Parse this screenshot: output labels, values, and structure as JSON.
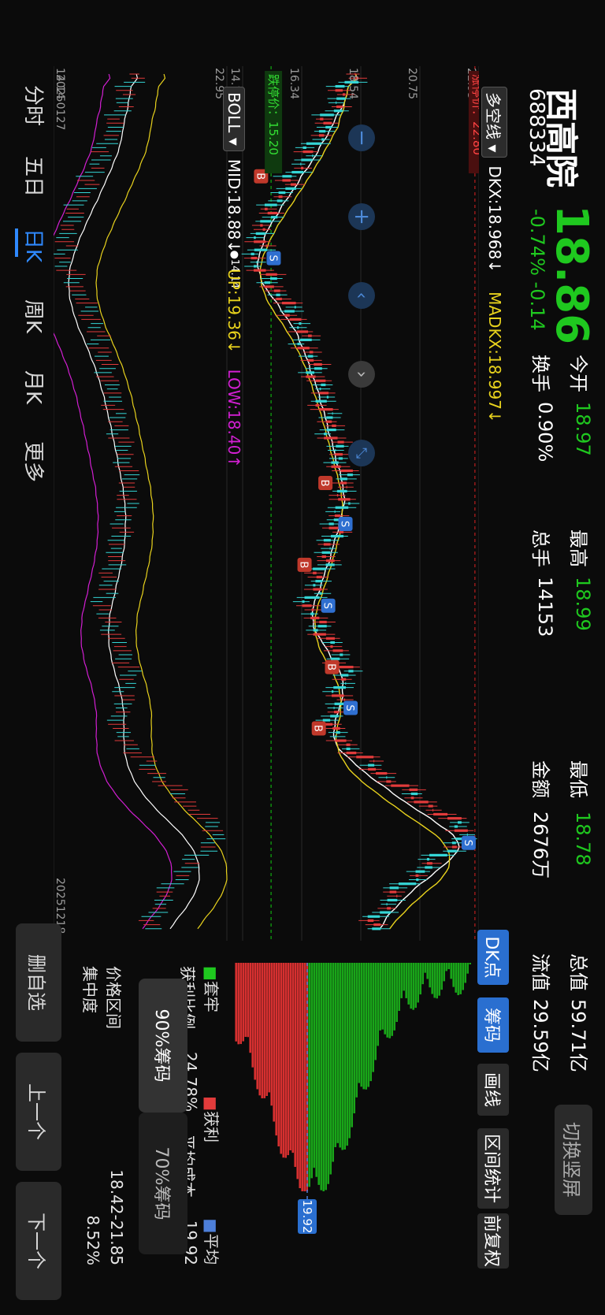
{
  "header": {
    "name": "西高院",
    "code": "688334",
    "price": "18.86",
    "change_pct": "-0.74%",
    "change_amt": "-0.14",
    "switch_label": "切换竖屏"
  },
  "stats": {
    "open": {
      "label": "今开",
      "value": "18.97"
    },
    "high": {
      "label": "最高",
      "value": "18.99"
    },
    "low": {
      "label": "最低",
      "value": "18.78"
    },
    "turnover": {
      "label": "换手",
      "value": "0.90%"
    },
    "volume": {
      "label": "总手",
      "value": "14153"
    },
    "amount": {
      "label": "金额",
      "value": "2676万"
    },
    "market_cap": {
      "label": "总值",
      "value": "59.71亿"
    },
    "float_cap": {
      "label": "流值",
      "value": "29.59亿"
    }
  },
  "legend": {
    "indicator": "多空线",
    "dkx": "DKX:18.968↓",
    "madkx": "MADKX:18.997↓",
    "boll": "BOLL",
    "mid": "MID:18.88↓",
    "up": "UP:19.36↓",
    "low": "LOW:18.40↑"
  },
  "right_tabs": [
    "DK点",
    "筹码",
    "画线",
    "区间统计",
    "前复权"
  ],
  "chips": {
    "avg_tag": "19.92",
    "legend_trapped": "套牢",
    "legend_profit": "获利",
    "legend_avg": "平均",
    "profit_ratio_label": "获利比例",
    "profit_ratio": "24.78%",
    "avg_cost_label": "平均成本",
    "avg_cost": "19.92",
    "seg90": "90%筹码",
    "seg70": "70%筹码",
    "range_label": "价格区间",
    "range": "18.42-21.85",
    "conc_label": "集中度",
    "concentration": "8.52%"
  },
  "periods": [
    "分时",
    "五日",
    "日K",
    "周K",
    "月K",
    "更多"
  ],
  "bottom": {
    "remove": "删自选",
    "prev": "上一个",
    "next": "下一个"
  },
  "chart_labels": {
    "limit_up": "涨停价：22.80",
    "limit_down": "跌停价：15.20",
    "y_ticks": [
      "22.95",
      "20.75",
      "18.54",
      "16.34",
      "14.14"
    ],
    "boll_ticks": [
      "22.95",
      "14.14"
    ],
    "dates": [
      "20250127",
      "20251218"
    ],
    "high_marker": "22.95",
    "low_marker": "14.14"
  },
  "colors": {
    "up": "#e23b3b",
    "down": "#35d6d6",
    "dkx": "#ffffff",
    "madkx": "#e8d21d",
    "boll_low": "#d21fd2",
    "chip_profit": "#d63030",
    "chip_trapped": "#19a519"
  }
}
